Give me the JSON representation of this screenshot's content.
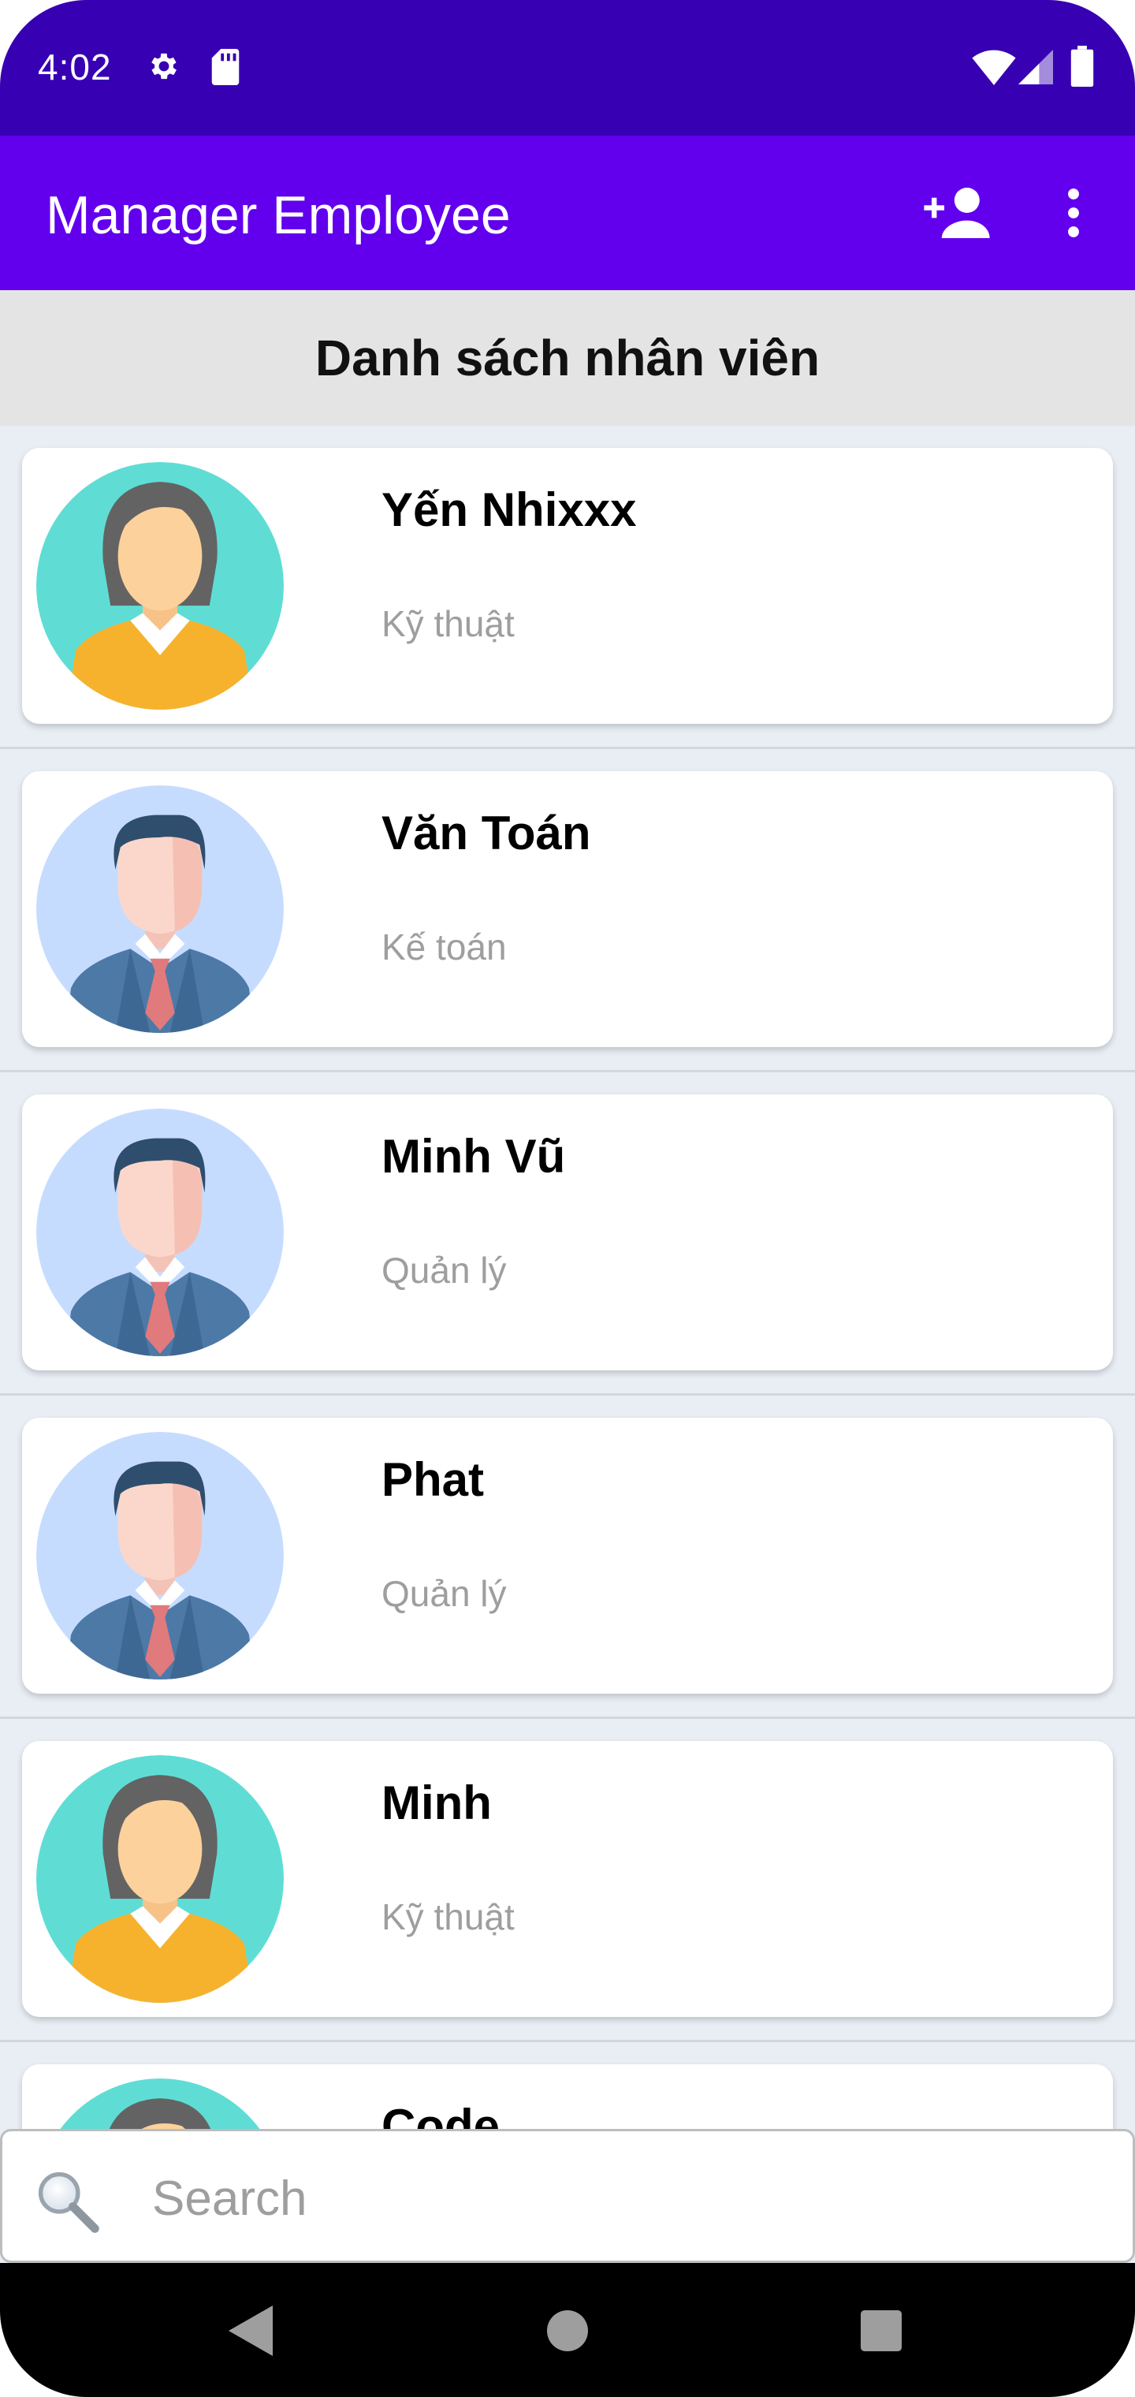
{
  "status_bar": {
    "time": "4:02"
  },
  "app_bar": {
    "title": "Manager Employee",
    "add_icon": "person-add-icon",
    "menu_icon": "more-vert-icon"
  },
  "list": {
    "header": "Danh sách nhân viên",
    "employees": [
      {
        "name": "Yến Nhixxx",
        "department": "Kỹ thuật",
        "avatar": "female"
      },
      {
        "name": "Văn Toán",
        "department": "Kế toán",
        "avatar": "male"
      },
      {
        "name": "Minh Vũ",
        "department": "Quản lý",
        "avatar": "male"
      },
      {
        "name": "Phat",
        "department": "Quản lý",
        "avatar": "male"
      },
      {
        "name": "Minh",
        "department": "Kỹ thuật",
        "avatar": "female"
      },
      {
        "name": "Code",
        "department": "",
        "avatar": "female"
      }
    ]
  },
  "search": {
    "placeholder": "Search",
    "value": ""
  },
  "colors": {
    "status_bar": "#3700b3",
    "app_bar": "#6200ee",
    "female_bg": "#5fddd5",
    "male_bg": "#c6dcff"
  }
}
